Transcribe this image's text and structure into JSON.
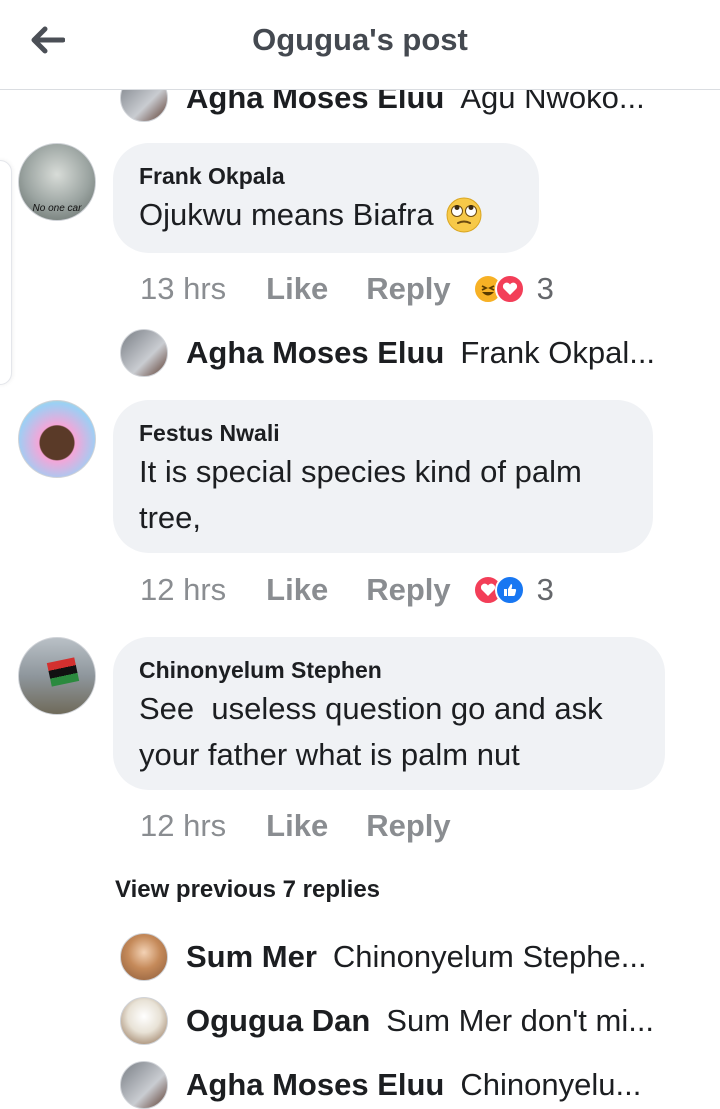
{
  "header": {
    "title": "Ogugua's post",
    "back_icon": "arrow-left-icon"
  },
  "top_reply": {
    "name": "Agha Moses Eluu",
    "text": "Agu Nwoko..."
  },
  "comments": [
    {
      "author": "Frank Okpala",
      "lines": [
        "Ojukwu means Biafra"
      ],
      "emoji": "eye-roll-emoji-icon",
      "avatar_caption": "No one car",
      "time": "13 hrs",
      "like_label": "Like",
      "reply_label": "Reply",
      "reactions": [
        "haha-reaction-icon",
        "love-reaction-icon"
      ],
      "reaction_count": "3",
      "reply": {
        "name": "Agha Moses Eluu",
        "text": "Frank Okpal..."
      }
    },
    {
      "author": "Festus Nwali",
      "lines": [
        "It is special species kind of palm",
        "tree,"
      ],
      "time": "12 hrs",
      "like_label": "Like",
      "reply_label": "Reply",
      "reactions": [
        "love-reaction-icon",
        "like-reaction-icon"
      ],
      "reaction_count": "3"
    },
    {
      "author": "Chinonyelum Stephen",
      "lines": [
        "See  useless question go and ask",
        "your father what is palm nut"
      ],
      "time": "12 hrs",
      "like_label": "Like",
      "reply_label": "Reply"
    }
  ],
  "view_previous": "View previous 7 replies",
  "bottom_replies": [
    {
      "name": "Sum Mer",
      "text": "Chinonyelum Stephe..."
    },
    {
      "name": "Ogugua Dan",
      "text": "Sum Mer don't mi..."
    },
    {
      "name": "Agha Moses Eluu",
      "text": "Chinonyelu..."
    }
  ],
  "colors": {
    "bubble": "#f0f2f5",
    "meta_text": "#8a8d91",
    "like_blue": "#1877f2",
    "love_red": "#f33e58",
    "haha_yellow": "#f7b125"
  }
}
